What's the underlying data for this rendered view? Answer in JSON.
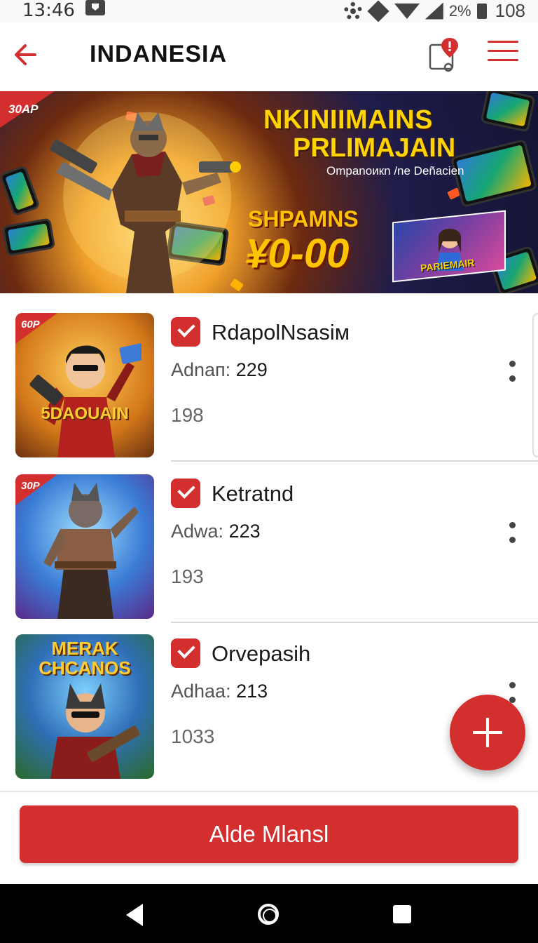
{
  "status_bar": {
    "time": "13:46",
    "battery_percent": "2%",
    "right_number": "108",
    "icons": [
      "notification-icon",
      "gear-icon",
      "diamond-icon",
      "wifi-icon",
      "signal-icon",
      "battery-icon"
    ]
  },
  "app_bar": {
    "title": "INDANESIA",
    "back_icon": "back-arrow-icon",
    "action_icons": [
      "location-pin-icon",
      "menu-icon"
    ]
  },
  "banner": {
    "badge": "30AP",
    "title_line1": "NKINIIMAINS",
    "title_line2": "PRLIMAJAIN",
    "subtitle": "Ompanoикn /ne Deñacien",
    "promo_label": "SHPAMNS",
    "promo_amount": "¥0-00",
    "poster_text": "PARIEMAIR"
  },
  "list": {
    "items": [
      {
        "badge": "60P",
        "thumb_text": "5DAOUAIN",
        "title": "RdapolNsasiм",
        "sub_label": "Adnaп:",
        "sub_value": "229",
        "count": "198",
        "checked": true
      },
      {
        "badge": "30P",
        "thumb_text": "",
        "title": "Ketratnd",
        "sub_label": "Adwa:",
        "sub_value": "223",
        "count": "193",
        "checked": true
      },
      {
        "badge": "",
        "thumb_text": "MERAK CHCANOS",
        "title": "Orvepasih",
        "sub_label": "Adhaa:",
        "sub_value": "213",
        "count": "1033",
        "checked": true
      }
    ]
  },
  "fab": {
    "icon": "plus-icon"
  },
  "primary_button": {
    "label": "Alde Mlansl"
  },
  "nav_bar": {
    "icons": [
      "nav-back-icon",
      "nav-home-icon",
      "nav-recents-icon"
    ]
  },
  "colors": {
    "accent": "#d32f2f",
    "banner_text": "#ffd400"
  }
}
